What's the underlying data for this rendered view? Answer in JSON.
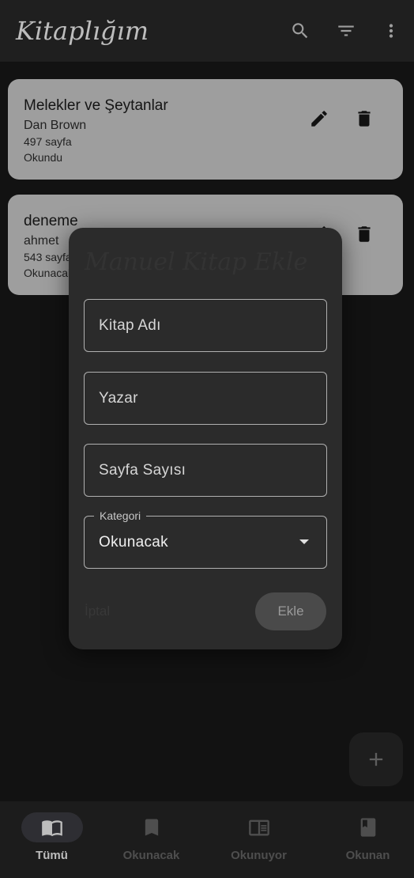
{
  "app_bar": {
    "title": "Kitaplığım",
    "icons": [
      "search-icon",
      "filter-icon",
      "more-vert-icon"
    ]
  },
  "books": [
    {
      "title": "Melekler ve Şeytanlar",
      "author": "Dan Brown",
      "pages": "497 sayfa",
      "status": "Okundu"
    },
    {
      "title": "deneme",
      "author": "ahmet",
      "pages": "543 sayfa",
      "status": "Okunacak"
    }
  ],
  "dialog": {
    "title": "Manuel Kitap Ekle",
    "name_placeholder": "Kitap Adı",
    "author_placeholder": "Yazar",
    "pages_placeholder": "Sayfa Sayısı",
    "category_label": "Kategori",
    "category_value": "Okunacak",
    "cancel_label": "İptal",
    "add_label": "Ekle"
  },
  "fab": {
    "icon": "add-icon"
  },
  "bottom_nav": {
    "items": [
      {
        "label": "Tümü",
        "icon": "open-book-icon",
        "active": true
      },
      {
        "label": "Okunacak",
        "icon": "bookmark-icon",
        "active": false
      },
      {
        "label": "Okunuyor",
        "icon": "reading-book-icon",
        "active": false
      },
      {
        "label": "Okunan",
        "icon": "closed-book-icon",
        "active": false
      }
    ]
  },
  "colors": {
    "background": "#121212",
    "card": "#9e9e9e",
    "dialog": "#2b2b2b",
    "active_nav": "#bdbdbd"
  }
}
